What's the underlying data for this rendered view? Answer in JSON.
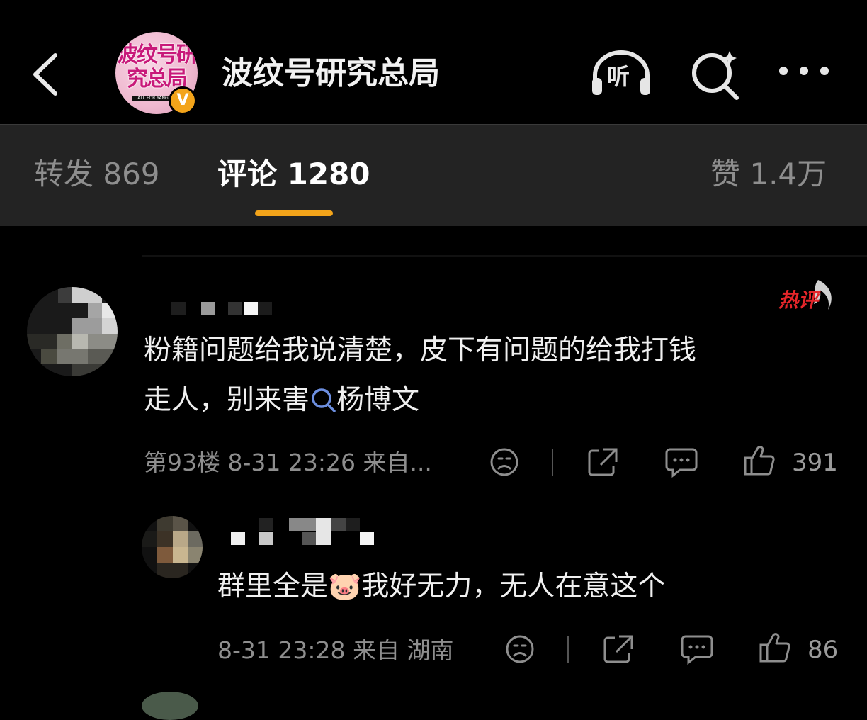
{
  "header": {
    "back_icon": "chevron-left-icon",
    "avatar_text": "波纹号研究总局",
    "avatar_tag": "ALL FOR YANG",
    "verified_badge": "V",
    "title": "波纹号研究总局",
    "listen_label": "听",
    "accent": "#f3a41a"
  },
  "tabs": {
    "repost": "转发 869",
    "comments": "评论 1280",
    "likes": "赞 1.4万"
  },
  "comment": {
    "hot_label": "热评",
    "text_line1": "粉籍问题给我说清楚，皮下有问题的给我打钱",
    "text_line2_prefix": "走人，别来害",
    "text_link": "杨博文",
    "meta": "第93楼 8-31 23:26 来自...",
    "like_count": "391"
  },
  "reply": {
    "text_prefix": "群里全是",
    "emoji": "🐷",
    "text_suffix": "我好无力，无人在意这个",
    "meta": "8-31 23:28 来自 湖南",
    "like_count": "86"
  }
}
